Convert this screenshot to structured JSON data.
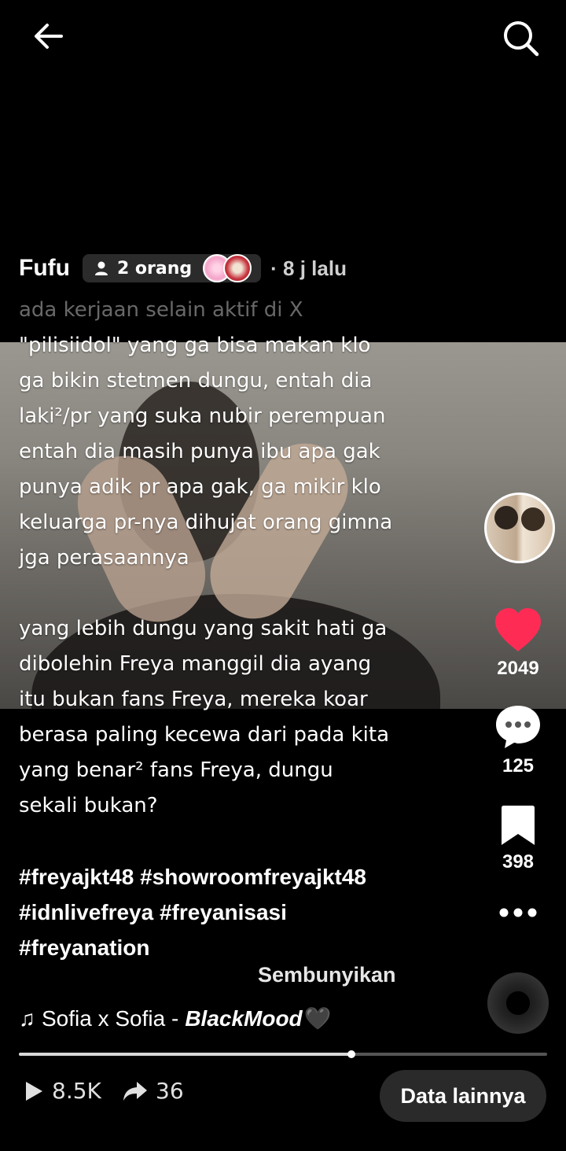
{
  "header": {
    "back_icon": "arrow-left-icon",
    "search_icon": "search-icon"
  },
  "post": {
    "author": "Fufu",
    "collab_label": "2 orang",
    "time_ago": "· 8 j lalu",
    "caption_lines": [
      "ada kerjaan selain aktif di X",
      "\"pilisiidol\" yang ga bisa makan klo",
      "ga bikin stetmen dungu, entah dia",
      "laki²/pr yang suka nubir perempuan",
      "entah dia masih punya ibu apa gak",
      "punya adik pr apa gak, ga mikir klo",
      "keluarga pr-nya dihujat orang gimna",
      "jga perasaannya",
      "",
      "yang lebih dungu yang sakit hati ga",
      "dibolehin Freya manggil dia ayang",
      "itu bukan fans Freya, mereka koar",
      "berasa paling kecewa dari pada kita",
      "yang benar² fans Freya, dungu",
      "sekali bukan?",
      ""
    ],
    "hashtag_lines": [
      "#freyajkt48 #showroomfreyajkt48",
      "#idnlivefreya #freyanisasi",
      "#freyanation"
    ],
    "hide_label": "Sembunyikan",
    "music": {
      "artist": "Sofia x Sofia -",
      "track": "BlackMood",
      "emoji": "🖤"
    }
  },
  "actions": {
    "likes": "2049",
    "comments": "125",
    "saves": "398",
    "like_color": "#fe2c55"
  },
  "progress": {
    "fraction": 0.629
  },
  "bottom": {
    "views": "8.5K",
    "shares": "36",
    "more_data_label": "Data lainnya"
  }
}
